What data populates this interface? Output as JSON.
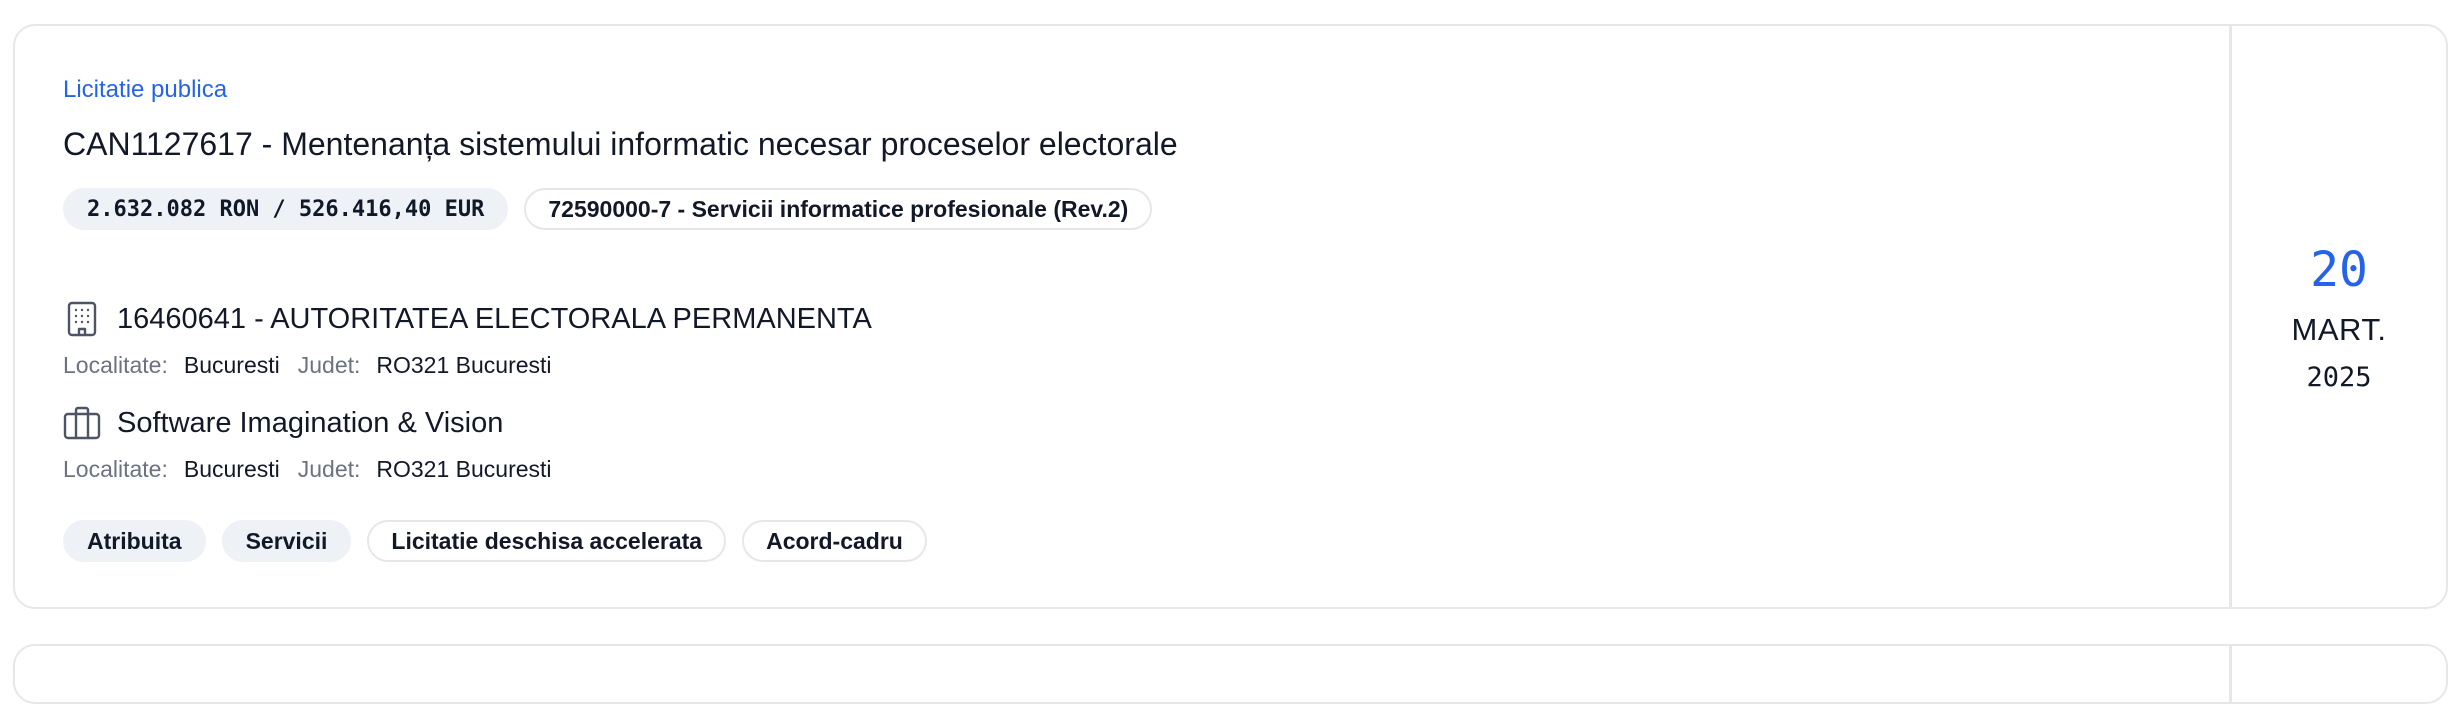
{
  "tender": {
    "procedure_type": "Licitatie publica",
    "title": "CAN1127617 - Mentenanța sistemului informatic necesar proceselor electorale",
    "value": "2.632.082 RON / 526.416,40 EUR",
    "cpv": "72590000-7 - Servicii informatice profesionale (Rev.2)",
    "authority": {
      "icon": "building-icon",
      "name": "16460641 - AUTORITATEA ELECTORALA PERMANENTA",
      "locality_label": "Localitate:",
      "locality": "Bucuresti",
      "county_label": "Judet:",
      "county": "RO321 Bucuresti"
    },
    "supplier": {
      "icon": "briefcase-icon",
      "name": "Software Imagination & Vision",
      "locality_label": "Localitate:",
      "locality": "Bucuresti",
      "county_label": "Judet:",
      "county": "RO321 Bucuresti"
    },
    "tags": {
      "status": "Atribuita",
      "category": "Servicii",
      "procedure": "Licitatie deschisa accelerata",
      "contract_type": "Acord-cadru"
    },
    "date": {
      "day": "20",
      "month": "MART.",
      "year": "2025"
    }
  },
  "colors": {
    "accent": "#2563eb",
    "text": "#111827",
    "muted": "#6b7280",
    "border": "#e5e7eb",
    "pill_fill": "#eef1f6"
  }
}
